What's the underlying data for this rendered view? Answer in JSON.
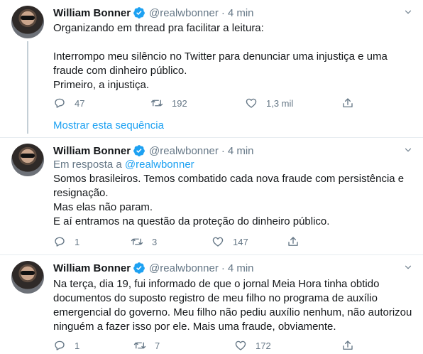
{
  "tweets": [
    {
      "name": "William Bonner",
      "handle": "@realwbonner",
      "separator": "·",
      "time": "4 min",
      "lines": [
        "Organizando em thread pra facilitar a leitura:",
        "",
        "Interrompo meu silêncio no Twitter para denunciar uma injustiça e uma",
        "fraude com dinheiro público.",
        "Primeiro, a injustiça."
      ],
      "replies": "47",
      "retweets": "192",
      "likes": "1,3 mil"
    },
    {
      "name": "William Bonner",
      "handle": "@realwbonner",
      "separator": "·",
      "time": "4 min",
      "reply_prefix": "Em resposta a",
      "reply_handle": "@realwbonner",
      "lines": [
        "Somos brasileiros. Temos combatido cada nova fraude com persistência e",
        "resignação.",
        "Mas elas não param.",
        "E aí entramos na questão da proteção do dinheiro público."
      ],
      "replies": "1",
      "retweets": "3",
      "likes": "147"
    },
    {
      "name": "William Bonner",
      "handle": "@realwbonner",
      "separator": "·",
      "time": "4 min",
      "lines": [
        "Na terça, dia 19, fui informado de que o jornal Meia Hora tinha obtido",
        "documentos do suposto registro de meu filho no programa de auxílio",
        "emergencial do governo. Meu filho não pediu auxílio nenhum, não autorizou",
        "ninguém a fazer isso por ele. Mais uma fraude, obviamente."
      ],
      "replies": "1",
      "retweets": "7",
      "likes": "172"
    }
  ],
  "show_thread": "Mostrar esta sequência",
  "colors": {
    "accent": "#1da1f2",
    "secondary": "#657786",
    "text": "#14171a",
    "thread_line": "#c4cfd6"
  },
  "icons": [
    "verified-badge-icon",
    "chevron-down-icon",
    "reply-icon",
    "retweet-icon",
    "like-icon",
    "share-icon"
  ]
}
